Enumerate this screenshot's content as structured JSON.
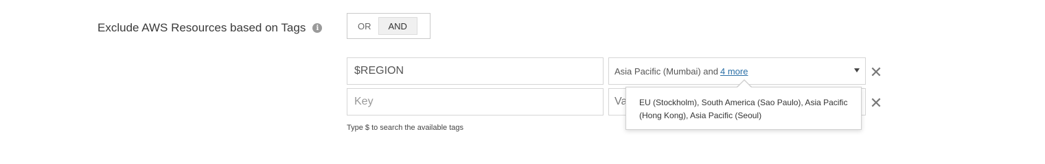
{
  "filter": {
    "label": "Exclude AWS Resources based on Tags",
    "info_icon": "info-icon",
    "toggle": {
      "options": [
        "OR",
        "AND"
      ],
      "selected": "AND"
    }
  },
  "rows": [
    {
      "key_value": "$REGION",
      "value_text": "Asia Pacific (Mumbai) and",
      "more_text": "4 more"
    },
    {
      "key_placeholder": "Key",
      "value_placeholder": "Va"
    }
  ],
  "hint": "Type $ to search the available tags",
  "tooltip": {
    "text": "EU (Stockholm), South America (Sao Paulo), Asia Pacific (Hong Kong), Asia Pacific (Seoul)"
  },
  "icons": {
    "remove": "close-icon",
    "dropdown": "chevron-down-icon"
  },
  "remove_glyph": "✕"
}
